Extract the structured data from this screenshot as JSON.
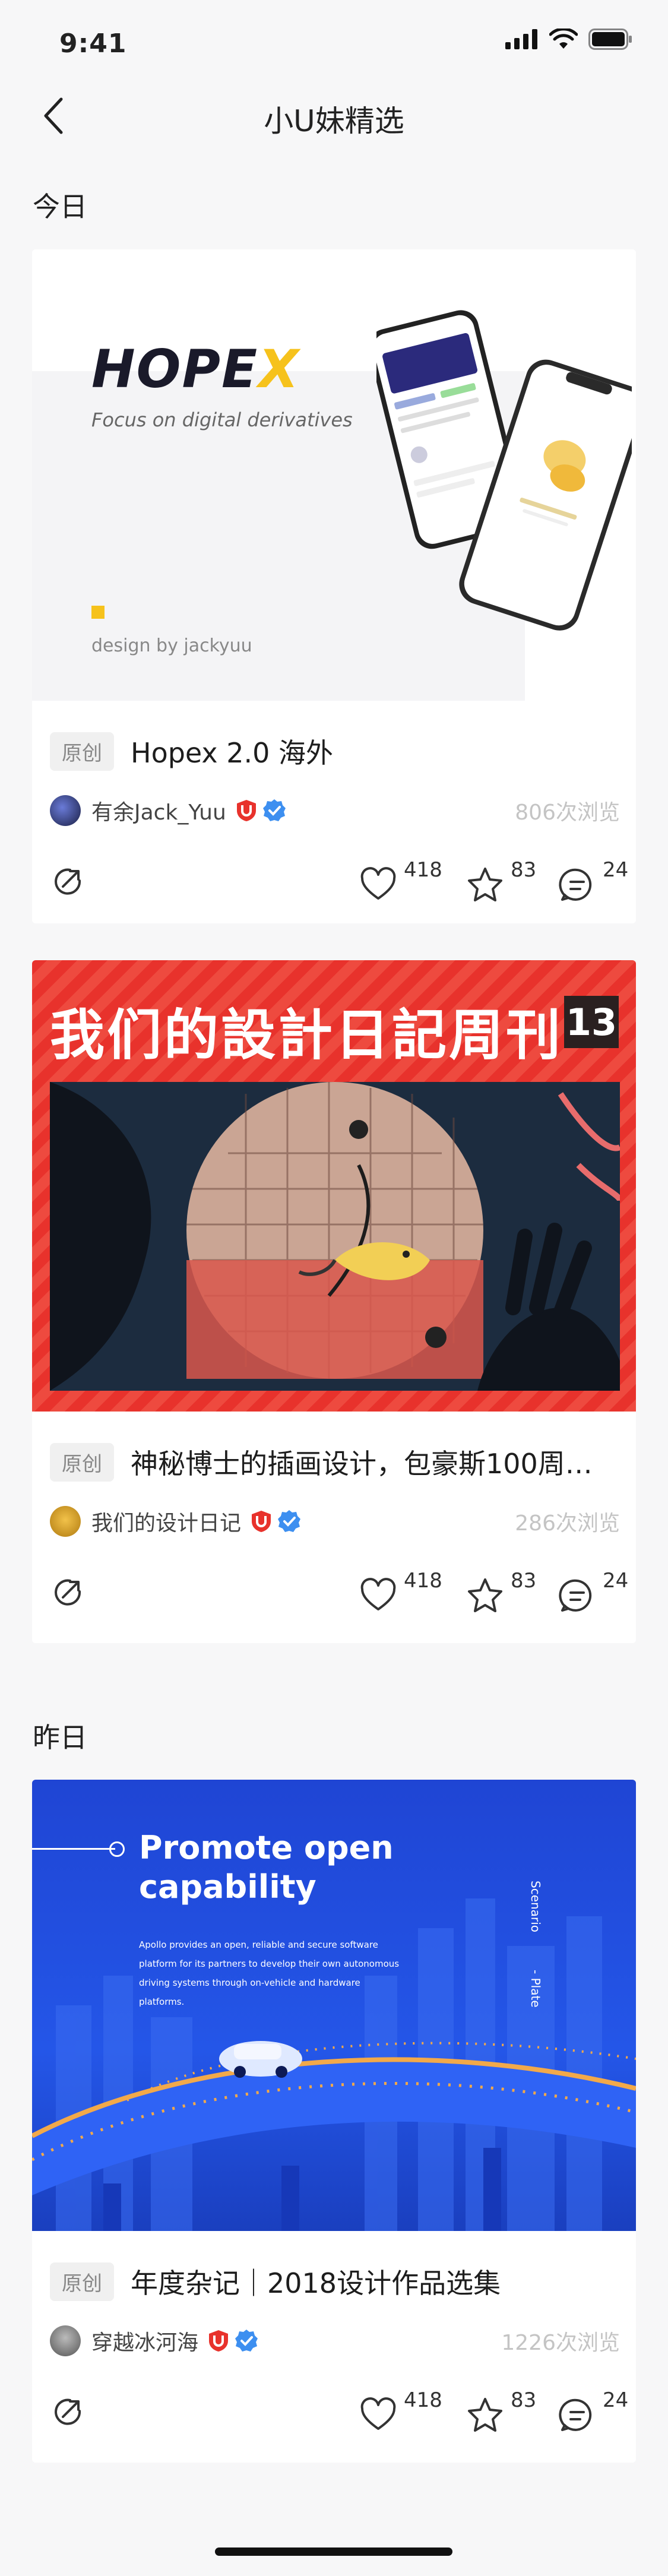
{
  "status": {
    "time": "9:41"
  },
  "nav": {
    "title": "小U妹精选"
  },
  "sections": [
    {
      "title": "今日"
    },
    {
      "title": "昨日"
    }
  ],
  "cards": [
    {
      "tag": "原创",
      "title": "Hopex 2.0 海外",
      "author": "有余Jack_Yuu",
      "views": "806次浏览",
      "likes": "418",
      "stars": "83",
      "comments": "24",
      "image": {
        "brand": "HOPEX",
        "tagline": "Focus on digital derivatives",
        "credit": "design by jackyuu"
      }
    },
    {
      "tag": "原创",
      "title": "神秘博士的插画设计，包豪斯100周…",
      "author": "我们的设计日记",
      "views": "286次浏览",
      "likes": "418",
      "stars": "83",
      "comments": "24",
      "image": {
        "headline": "我们的設計日記周刊",
        "issue": "13"
      }
    },
    {
      "tag": "原创",
      "title": "年度杂记｜2018设计作品选集",
      "author": "穿越冰河海",
      "views": "1226次浏览",
      "likes": "418",
      "stars": "83",
      "comments": "24",
      "image": {
        "headline_line1": "Promote open",
        "headline_line2": "capability",
        "body": "Apollo provides an open, reliable and secure software platform for its partners to develop their own autonomous driving systems through on-vehicle and hardware platforms.",
        "side_label_1": "Scenario",
        "side_label_2": "- Plate"
      }
    }
  ],
  "colors": {
    "accent_red": "#e8322c",
    "verified_blue": "#3d8ff0",
    "hopex_yellow": "#f6c21c",
    "apollo_blue": "#1e4fd8"
  }
}
